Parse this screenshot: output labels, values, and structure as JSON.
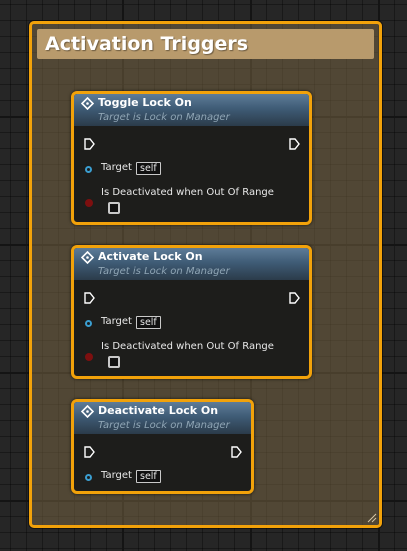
{
  "comment": {
    "title": "Activation Triggers",
    "border_color": "#f2a20a"
  },
  "nodes": [
    {
      "title": "Toggle Lock On",
      "subtitle": "Target is Lock on Manager",
      "target_label": "Target",
      "target_value": "self",
      "bool_label": "Is Deactivated when Out Of Range",
      "bool_checked": false
    },
    {
      "title": "Activate Lock On",
      "subtitle": "Target is Lock on Manager",
      "target_label": "Target",
      "target_value": "self",
      "bool_label": "Is Deactivated when Out Of Range",
      "bool_checked": false
    },
    {
      "title": "Deactivate Lock On",
      "subtitle": "Target is Lock on Manager",
      "target_label": "Target",
      "target_value": "self"
    }
  ],
  "icons": {
    "function": "function-diamond-icon",
    "exec": "exec-pin-icon",
    "object_pin": "object-pin-icon",
    "bool_pin": "bool-pin-icon",
    "resize": "resize-grip-icon"
  },
  "colors": {
    "selection": "#f2a20a",
    "header_blue": "#3f5c76",
    "object_pin": "#3b9ed0",
    "bool_pin": "#7d0f0f"
  }
}
